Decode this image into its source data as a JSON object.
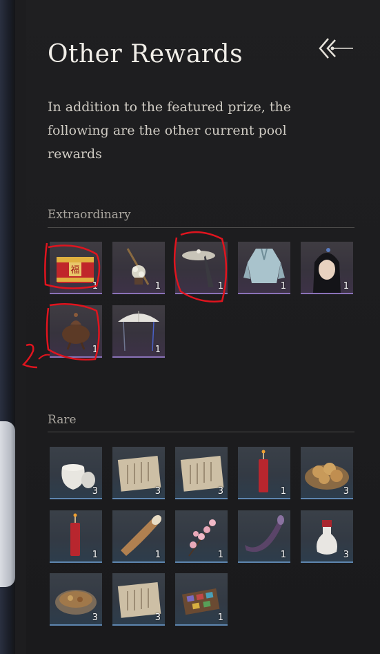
{
  "header": {
    "title": "Other Rewards",
    "back_icon": "double-chevron-left-icon"
  },
  "description": "In addition to the featured prize, the following are the other current pool rewards",
  "sections": {
    "extraordinary": {
      "label": "Extraordinary",
      "items": [
        {
          "name": "red-firecracker-box",
          "qty": "1"
        },
        {
          "name": "flower-pole-ornament",
          "qty": "1"
        },
        {
          "name": "veiled-bamboo-hat",
          "qty": "1"
        },
        {
          "name": "pale-blue-robe",
          "qty": "1"
        },
        {
          "name": "hairstyle",
          "qty": "1"
        },
        {
          "name": "bronze-incense-burner",
          "qty": "1"
        },
        {
          "name": "white-gauze-hat",
          "qty": "1"
        }
      ]
    },
    "rare": {
      "label": "Rare",
      "items": [
        {
          "name": "white-porcelain-jar",
          "qty": "3"
        },
        {
          "name": "paper-scroll-1",
          "qty": "3"
        },
        {
          "name": "paper-scroll-2",
          "qty": "3"
        },
        {
          "name": "red-firecracker",
          "qty": "1"
        },
        {
          "name": "pastry-basket",
          "qty": "3"
        },
        {
          "name": "red-firecracker-2",
          "qty": "1"
        },
        {
          "name": "war-horn",
          "qty": "1"
        },
        {
          "name": "plum-blossom-branch",
          "qty": "1"
        },
        {
          "name": "purple-horn",
          "qty": "1"
        },
        {
          "name": "white-vase",
          "qty": "3"
        },
        {
          "name": "food-bowl",
          "qty": "3"
        },
        {
          "name": "paper-scroll-3",
          "qty": "3"
        },
        {
          "name": "paint-box",
          "qty": "1"
        }
      ]
    }
  },
  "annotation": {
    "note_mark": "2",
    "color": "#e0141e"
  }
}
